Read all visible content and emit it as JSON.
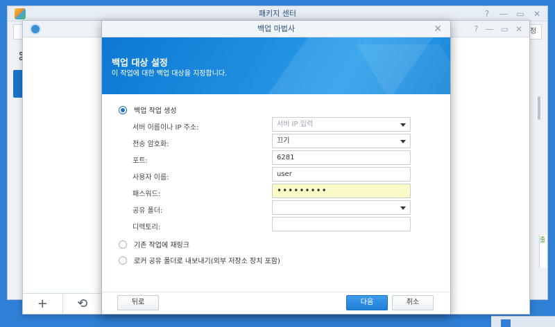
{
  "package_center": {
    "title": "패키지 센터",
    "controls": [
      "?",
      "—",
      "▭",
      "✕"
    ],
    "toolbar_chip": "정",
    "right_fragment": "줄"
  },
  "backup_app": {
    "controls": [
      "?",
      "—",
      "▭",
      "✕"
    ],
    "footer": {
      "add_glyph": "+",
      "history_glyph": "⟲"
    }
  },
  "dialog": {
    "title": "백업 마법사",
    "close": "✕",
    "heading": "백업 대상 설정",
    "subheading": "이 작업에 대한 백업 대상을 지정합니다.",
    "options": {
      "create_task": "백업 작업 생성",
      "relink_task": "기존 작업에 재링크",
      "export_local": "로커 공유 폴더로 내보내기(외부 저장소 장치 포함)"
    },
    "fields": {
      "server": {
        "label": "서버 이름이나 IP 주소:",
        "placeholder": "서버 IP 입력"
      },
      "encryption": {
        "label": "전송 암호화:",
        "value": "끄기"
      },
      "port": {
        "label": "포트:",
        "value": "6281"
      },
      "username": {
        "label": "사용자 이름:",
        "value": "user"
      },
      "password": {
        "label": "패스워드:",
        "value": "•••••••••"
      },
      "shared_folder": {
        "label": "공유 폴더:",
        "value": ""
      },
      "directory": {
        "label": "디렉토리:",
        "value": ""
      }
    },
    "buttons": {
      "back": "뒤로",
      "next": "다음",
      "cancel": "취소"
    }
  }
}
